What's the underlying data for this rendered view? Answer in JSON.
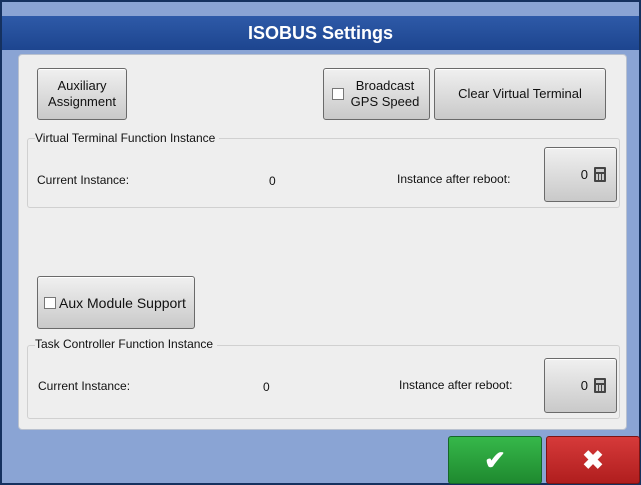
{
  "window": {
    "title": "ISOBUS Settings"
  },
  "top_buttons": {
    "aux_assignment": "Auxiliary Assignment",
    "broadcast_gps": "Broadcast GPS Speed",
    "broadcast_gps_checked": false,
    "clear_vt": "Clear Virtual Terminal"
  },
  "vt_group": {
    "label": "Virtual Terminal Function Instance",
    "current_label": "Current Instance:",
    "current_value": "0",
    "reboot_label": "Instance after reboot:",
    "reboot_value": "0"
  },
  "aux_module": {
    "label": "Aux Module Support",
    "checked": false
  },
  "tc_group": {
    "label": "Task Controller Function Instance",
    "current_label": "Current Instance:",
    "current_value": "0",
    "reboot_label": "Instance after reboot:",
    "reboot_value": "0"
  },
  "footer": {
    "ok_symbol": "✔",
    "cancel_symbol": "✖"
  },
  "icons": [
    "calculator-icon",
    "checkmark-icon",
    "close-icon",
    "checkbox-icon"
  ]
}
